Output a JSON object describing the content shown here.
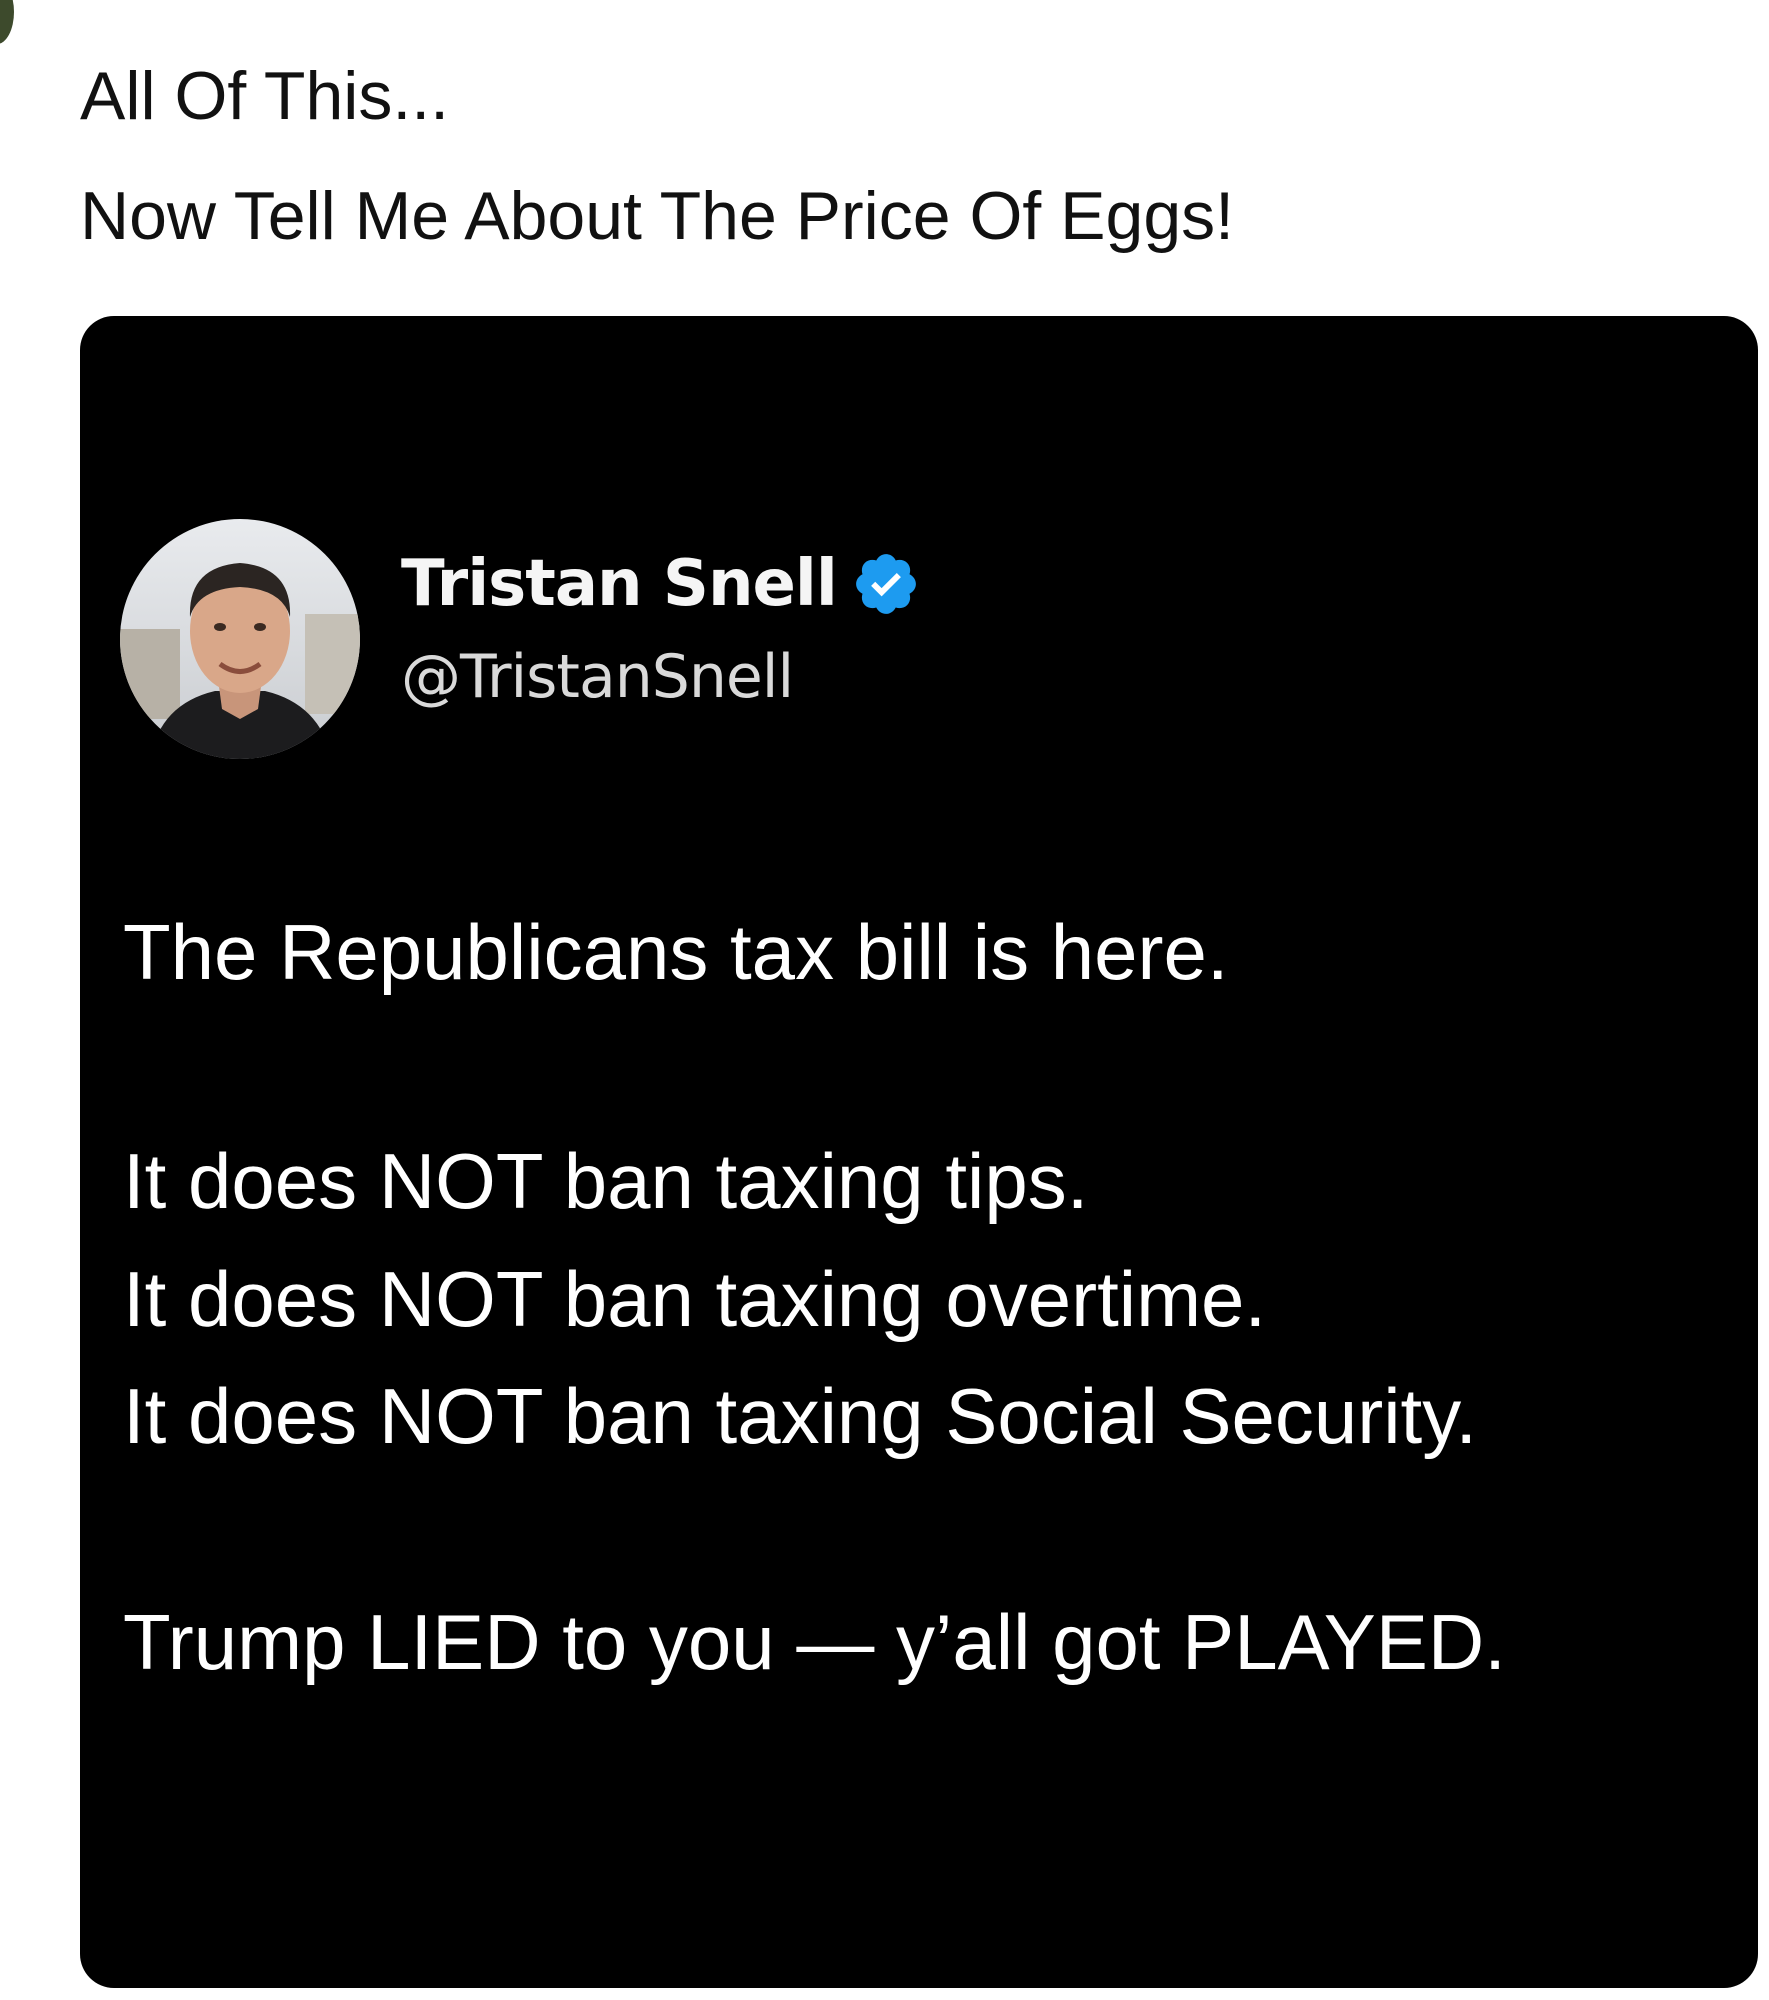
{
  "caption": {
    "line1": "All Of This...",
    "line2": "Now Tell Me About The Price Of Eggs!"
  },
  "tweet": {
    "author": {
      "name": "Tristan Snell",
      "handle": "@TristanSnell",
      "verified": true,
      "avatar_icon": "profile-photo"
    },
    "lines": [
      "The Republicans tax bill is here.",
      "It does NOT ban taxing tips.",
      "It does NOT ban taxing overtime.",
      "It does NOT ban taxing Social Security.",
      "Trump LIED to you — y’all got PLAYED."
    ],
    "colors": {
      "background": "#000000",
      "text": "#ffffff",
      "verified_badge": "#1d9bf0"
    }
  }
}
